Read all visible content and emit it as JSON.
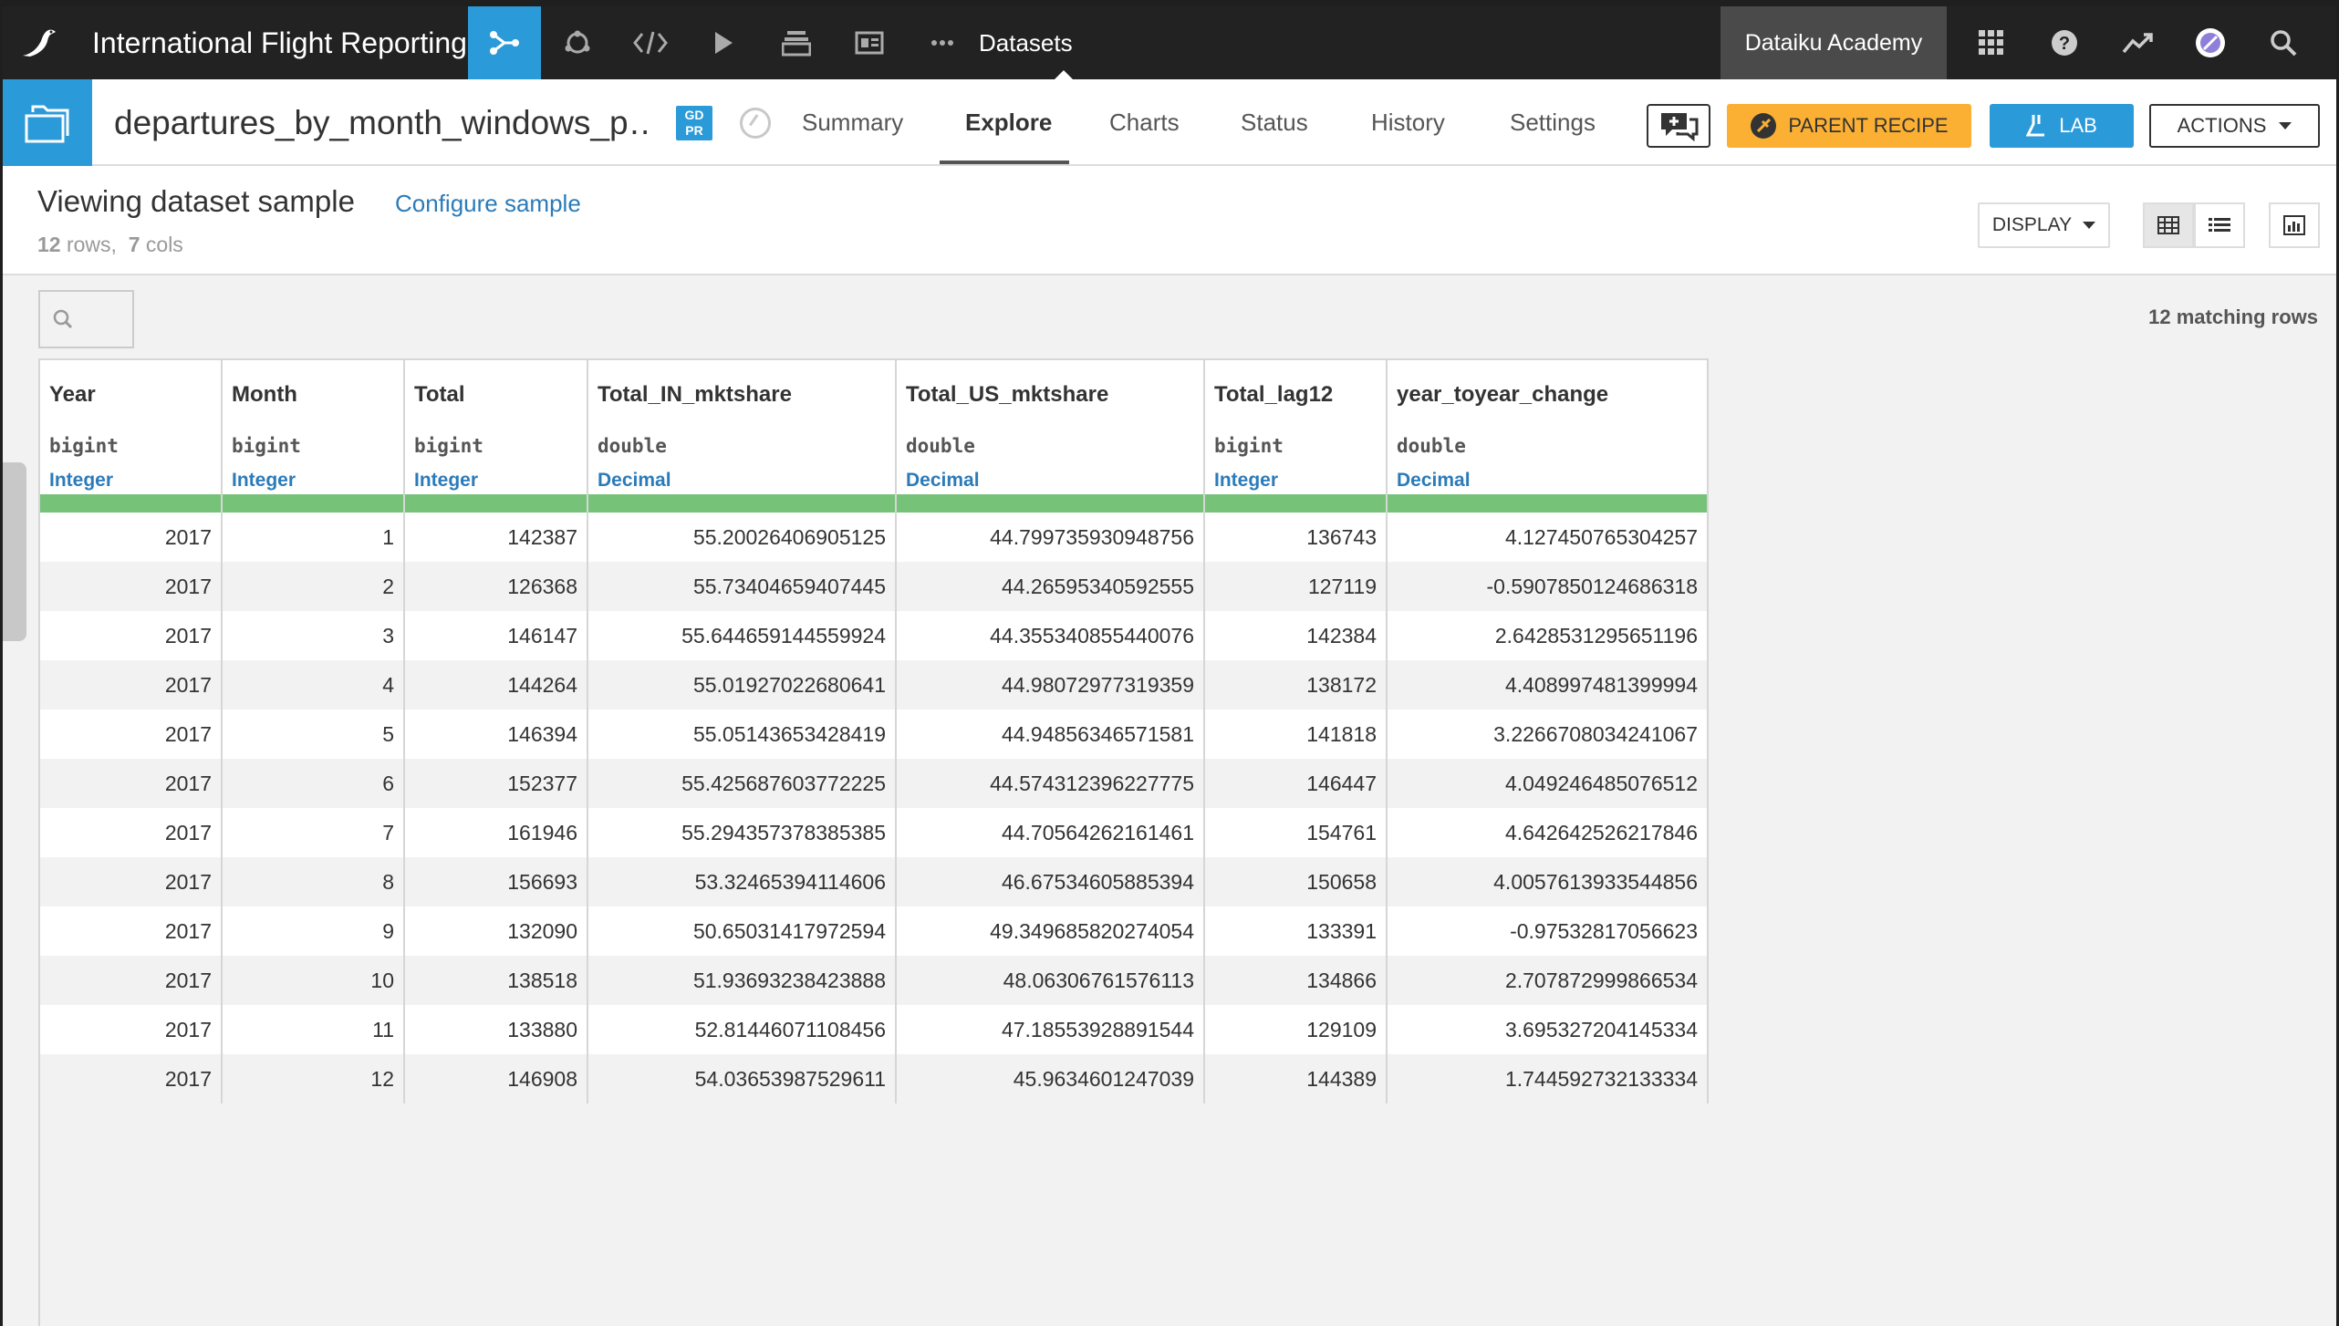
{
  "topbar": {
    "project_name": "International Flight Reporting",
    "nav_label": "Datasets",
    "academy_label": "Dataiku Academy"
  },
  "icons": {
    "logo": "dataiku-bird-icon",
    "flow": "flow-icon",
    "lab": "lab-icon",
    "code": "code-icon",
    "run": "run-icon",
    "notebooks": "notebooks-icon",
    "dashboards": "dashboards-icon",
    "more": "more-icon",
    "apps": "apps-grid-icon",
    "help": "help-icon",
    "activity": "activity-icon",
    "avatar": "avatar-icon",
    "search": "search-icon"
  },
  "subbar": {
    "dataset_name": "departures_by_month_windows_p…",
    "gdpr_line1": "GD",
    "gdpr_line2": "PR",
    "tabs": [
      "Summary",
      "Explore",
      "Charts",
      "Status",
      "History",
      "Settings"
    ],
    "active_tab": "Explore",
    "parent_recipe_label": "PARENT RECIPE",
    "lab_label": "LAB",
    "actions_label": "ACTIONS"
  },
  "sample": {
    "title": "Viewing dataset sample",
    "configure_label": "Configure sample",
    "rows_count": "12",
    "rows_word": "rows,",
    "cols_count": "7",
    "cols_word": "cols",
    "display_label": "DISPLAY",
    "matching_rows": "12 matching rows"
  },
  "table": {
    "columns": [
      {
        "name": "Year",
        "type": "bigint",
        "meaning": "Integer"
      },
      {
        "name": "Month",
        "type": "bigint",
        "meaning": "Integer"
      },
      {
        "name": "Total",
        "type": "bigint",
        "meaning": "Integer"
      },
      {
        "name": "Total_IN_mktshare",
        "type": "double",
        "meaning": "Decimal"
      },
      {
        "name": "Total_US_mktshare",
        "type": "double",
        "meaning": "Decimal"
      },
      {
        "name": "Total_lag12",
        "type": "bigint",
        "meaning": "Integer"
      },
      {
        "name": "year_toyear_change",
        "type": "double",
        "meaning": "Decimal"
      }
    ],
    "rows": [
      [
        "2017",
        "1",
        "142387",
        "55.20026406905125",
        "44.799735930948756",
        "136743",
        "4.127450765304257"
      ],
      [
        "2017",
        "2",
        "126368",
        "55.73404659407445",
        "44.26595340592555",
        "127119",
        "-0.5907850124686318"
      ],
      [
        "2017",
        "3",
        "146147",
        "55.644659144559924",
        "44.355340855440076",
        "142384",
        "2.6428531295651196"
      ],
      [
        "2017",
        "4",
        "144264",
        "55.01927022680641",
        "44.98072977319359",
        "138172",
        "4.408997481399994"
      ],
      [
        "2017",
        "5",
        "146394",
        "55.05143653428419",
        "44.94856346571581",
        "141818",
        "3.2266708034241067"
      ],
      [
        "2017",
        "6",
        "152377",
        "55.425687603772225",
        "44.574312396227775",
        "146447",
        "4.049246485076512"
      ],
      [
        "2017",
        "7",
        "161946",
        "55.294357378385385",
        "44.70564262161461",
        "154761",
        "4.642642526217846"
      ],
      [
        "2017",
        "8",
        "156693",
        "53.32465394114606",
        "46.67534605885394",
        "150658",
        "4.0057613933544856"
      ],
      [
        "2017",
        "9",
        "132090",
        "50.65031417972594",
        "49.349685820274054",
        "133391",
        "-0.97532817056623"
      ],
      [
        "2017",
        "10",
        "138518",
        "51.93693238423888",
        "48.06306761576113",
        "134866",
        "2.707872999866534"
      ],
      [
        "2017",
        "11",
        "133880",
        "52.81446071108456",
        "47.18553928891544",
        "129109",
        "3.695327204145334"
      ],
      [
        "2017",
        "12",
        "146908",
        "54.03653987529611",
        "45.9634601247039",
        "144389",
        "1.744592732133334"
      ]
    ],
    "quality_color": "#76c279"
  },
  "colors": {
    "topbar_bg": "#222222",
    "accent_blue": "#2b9ad9",
    "parent_recipe_yellow": "#fbb034",
    "link_blue": "#2b7bb9",
    "valid_green": "#76c279"
  }
}
